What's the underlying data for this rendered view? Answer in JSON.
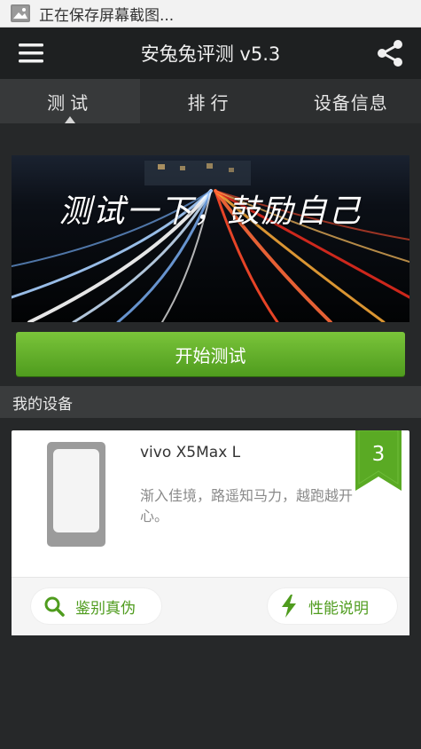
{
  "status_bar": {
    "text": "正在保存屏幕截图..."
  },
  "app_bar": {
    "title": "安兔兔评测 v5.3"
  },
  "tabs": [
    {
      "label": "测试",
      "active": true
    },
    {
      "label": "排行",
      "active": false
    },
    {
      "label": "设备信息",
      "active": false
    }
  ],
  "banner": {
    "text": "测试一下，鼓励自己"
  },
  "start_button": {
    "label": "开始测试"
  },
  "section": {
    "title": "我的设备"
  },
  "device": {
    "model": "vivo X5Max L",
    "description": "渐入佳境，路遥知马力，越跑越开心。",
    "rank": "3"
  },
  "actions": {
    "verify_label": "鉴别真伪",
    "performance_label": "性能说明"
  },
  "colors": {
    "accent_green": "#5aaa24",
    "background": "#262829",
    "appbar": "#1e2021"
  },
  "icons": [
    "image-icon",
    "menu-icon",
    "share-icon",
    "search-icon",
    "lightning-icon"
  ]
}
